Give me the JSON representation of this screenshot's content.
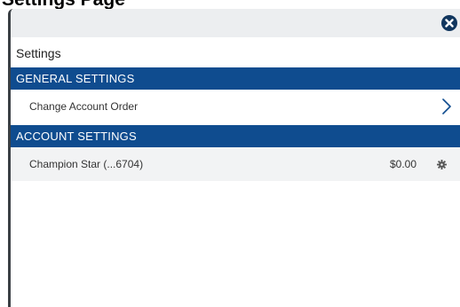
{
  "document": {
    "heading": "Settings Page"
  },
  "panel": {
    "title": "Settings",
    "close_icon": "close-circle-icon"
  },
  "sections": {
    "general": {
      "header": "GENERAL SETTINGS",
      "items": [
        {
          "label": "Change Account Order",
          "icon": "chevron-right-icon"
        }
      ]
    },
    "account": {
      "header": "ACCOUNT SETTINGS",
      "items": [
        {
          "label": "Champion Star (...6704)",
          "amount": "$0.00",
          "icon": "gear-icon"
        }
      ]
    }
  },
  "colors": {
    "header_blue": "#0f4c8f",
    "close_navy": "#11365e",
    "row_grey": "#f2f3f4"
  }
}
